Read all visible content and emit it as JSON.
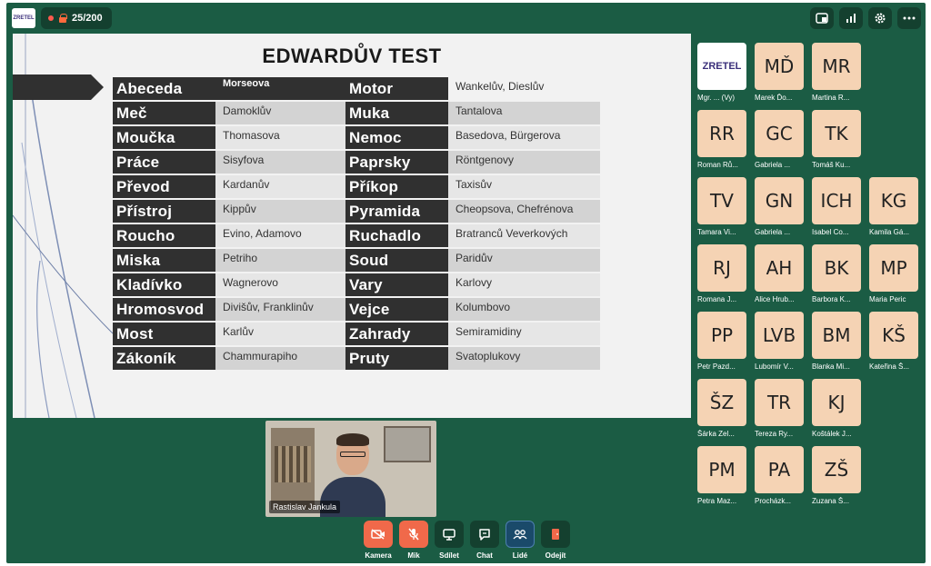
{
  "topbar": {
    "logo_text": "ZRETEL",
    "participant_count": "25/200"
  },
  "slide": {
    "title": "EDWARDŮV TEST",
    "rows": [
      {
        "term1": "Abeceda",
        "assoc1": "Morseova",
        "term2": "Motor",
        "assoc2": "Wankelův, Dieslův"
      },
      {
        "term1": "Meč",
        "assoc1": "Damoklův",
        "term2": "Muka",
        "assoc2": "Tantalova"
      },
      {
        "term1": "Moučka",
        "assoc1": "Thomasova",
        "term2": "Nemoc",
        "assoc2": "Basedova, Bürgerova"
      },
      {
        "term1": "Práce",
        "assoc1": "Sisyfova",
        "term2": "Paprsky",
        "assoc2": "Röntgenovy"
      },
      {
        "term1": "Převod",
        "assoc1": "Kardanův",
        "term2": "Příkop",
        "assoc2": "Taxisův"
      },
      {
        "term1": "Přístroj",
        "assoc1": "Kippův",
        "term2": "Pyramida",
        "assoc2": "Cheopsova, Chefrénova"
      },
      {
        "term1": "Roucho",
        "assoc1": "Evino, Adamovo",
        "term2": "Ruchadlo",
        "assoc2": "Bratranců Veverkových"
      },
      {
        "term1": "Miska",
        "assoc1": "Petriho",
        "term2": "Soud",
        "assoc2": "Paridův"
      },
      {
        "term1": "Kladívko",
        "assoc1": "Wagnerovo",
        "term2": "Vary",
        "assoc2": "Karlovy"
      },
      {
        "term1": "Hromosvod",
        "assoc1": "Divišův, Franklinův",
        "term2": "Vejce",
        "assoc2": "Kolumbovo"
      },
      {
        "term1": "Most",
        "assoc1": "Karlův",
        "term2": "Zahrady",
        "assoc2": "Semiramidiny"
      },
      {
        "term1": "Zákoník",
        "assoc1": "Chammurapiho",
        "term2": "Pruty",
        "assoc2": "Svatoplukovy"
      }
    ]
  },
  "participants": [
    {
      "initials": "ZRETEL",
      "name": "Mgr. ... (Vy)",
      "logo": true
    },
    {
      "initials": "MĎ",
      "name": "Marek Ďo..."
    },
    {
      "initials": "MR",
      "name": "Martina R..."
    },
    {
      "initials": "RR",
      "name": "Roman Rů..."
    },
    {
      "initials": "GC",
      "name": "Gabriela ..."
    },
    {
      "initials": "TK",
      "name": "Tomáš Ku..."
    },
    {
      "initials": "TV",
      "name": "Tamara Vi..."
    },
    {
      "initials": "GN",
      "name": "Gabriela ..."
    },
    {
      "initials": "ICH",
      "name": "Isabel Co..."
    },
    {
      "initials": "KG",
      "name": "Kamila Gá..."
    },
    {
      "initials": "RJ",
      "name": "Romana J..."
    },
    {
      "initials": "AH",
      "name": "Alice Hrub..."
    },
    {
      "initials": "BK",
      "name": "Barbora K..."
    },
    {
      "initials": "MP",
      "name": "Maria Peric"
    },
    {
      "initials": "PP",
      "name": "Petr Pazd..."
    },
    {
      "initials": "LVB",
      "name": "Lubomír V..."
    },
    {
      "initials": "BM",
      "name": "Blanka Mi..."
    },
    {
      "initials": "KŠ",
      "name": "Kateřina Š..."
    },
    {
      "initials": "ŠZ",
      "name": "Šárka Zel..."
    },
    {
      "initials": "TR",
      "name": "Tereza Ry..."
    },
    {
      "initials": "KJ",
      "name": "Koštálek J..."
    },
    {
      "initials": "PM",
      "name": "Petra Maz..."
    },
    {
      "initials": "PA",
      "name": "Procházk..."
    },
    {
      "initials": "ZŠ",
      "name": "Zuzana Š..."
    }
  ],
  "video": {
    "speaker_name": "Rastislav Jankula"
  },
  "controls": [
    {
      "label": "Kamera",
      "icon": "camera-off-icon"
    },
    {
      "label": "Mik",
      "icon": "mic-off-icon"
    },
    {
      "label": "Sdílet",
      "icon": "screen-share-icon"
    },
    {
      "label": "Chat",
      "icon": "chat-icon"
    },
    {
      "label": "Lidé",
      "icon": "people-icon"
    },
    {
      "label": "Odejít",
      "icon": "leave-icon"
    }
  ]
}
